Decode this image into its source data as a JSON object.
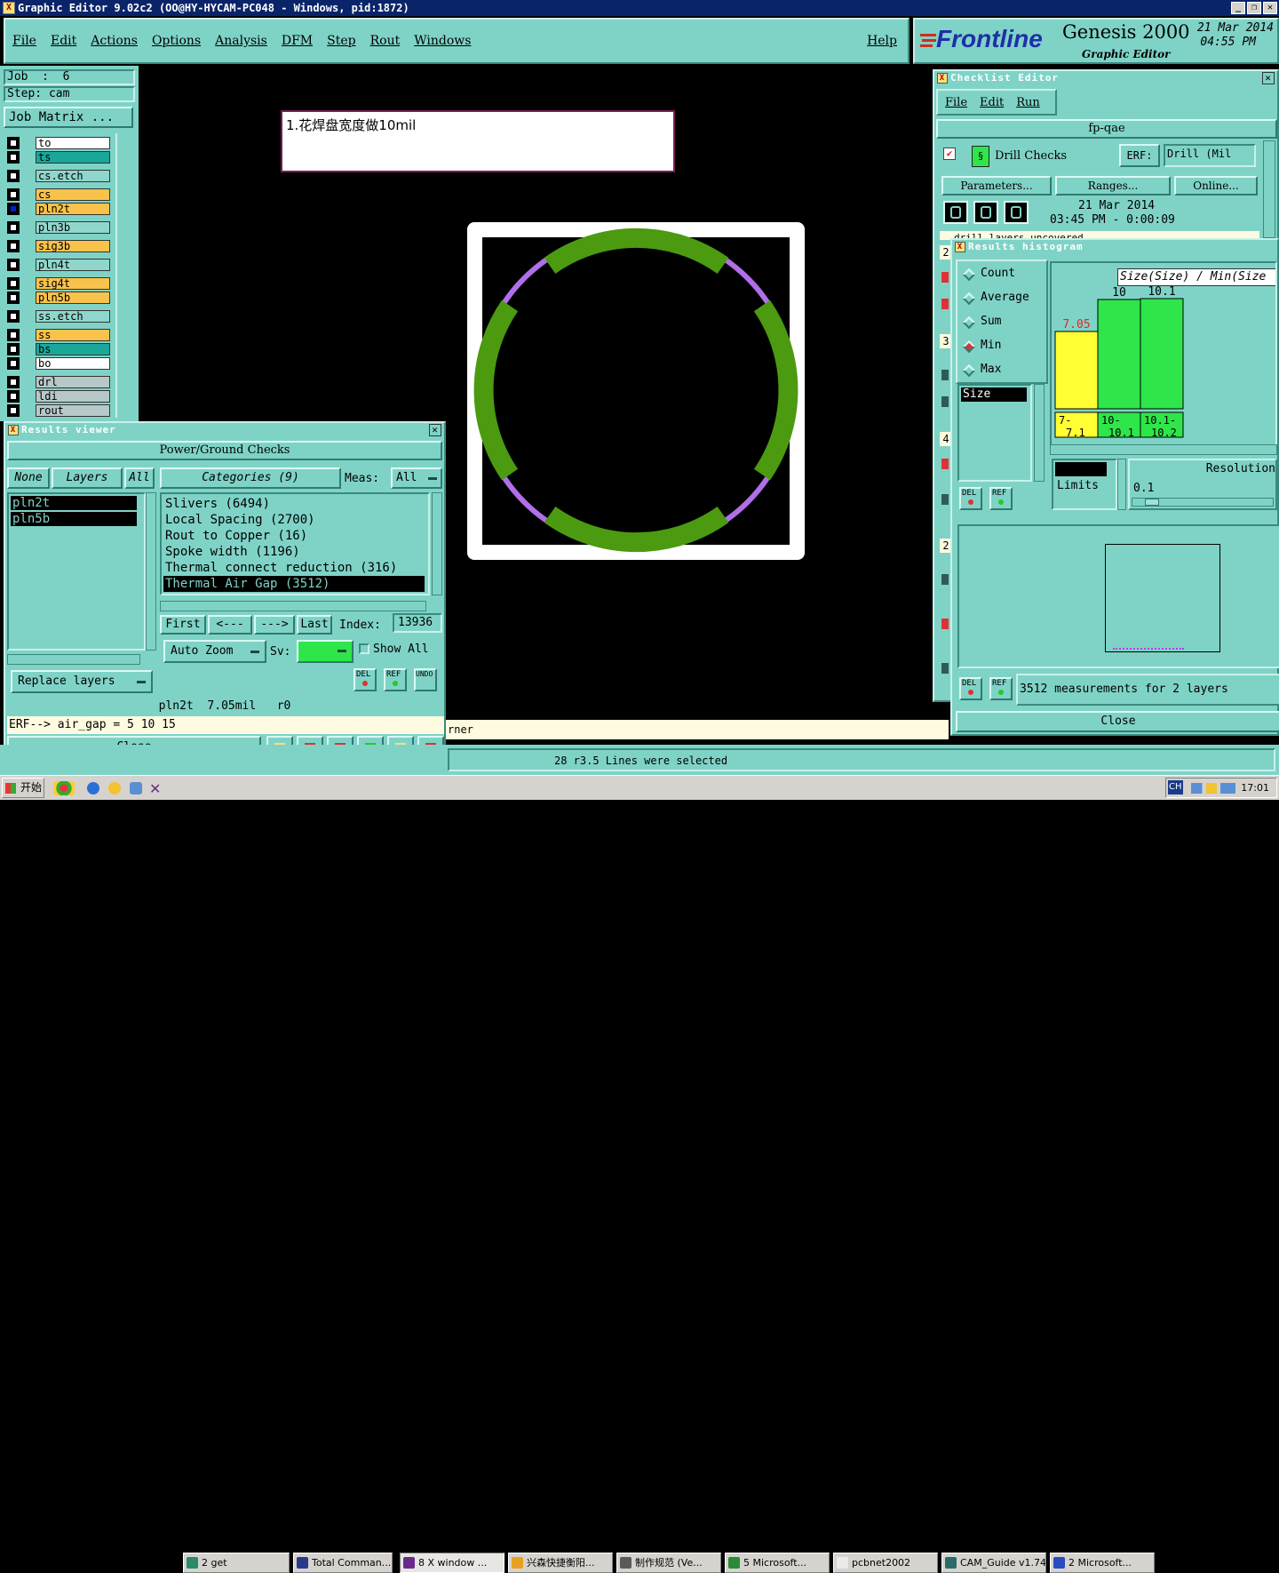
{
  "window": {
    "title": "Graphic Editor 9.02c2 (OO@HY-HYCAM-PC048 - Windows, pid:1872)"
  },
  "menubar": {
    "items": [
      "File",
      "Edit",
      "Actions",
      "Options",
      "Analysis",
      "DFM",
      "Step",
      "Rout",
      "Windows"
    ],
    "help": "Help"
  },
  "brand": {
    "logo": "Frontline",
    "product": "Genesis 2000",
    "subtitle": "Graphic Editor",
    "date": "21 Mar 2014",
    "time": "04:55 PM"
  },
  "job": {
    "job_label": "Job  :  6",
    "step_label": "Step: cam",
    "matrix_button": "Job Matrix ..."
  },
  "layers": [
    {
      "name": "to",
      "color": "#ffffff"
    },
    {
      "name": "ts",
      "color": "#1aa79a"
    },
    {
      "name": "cs.etch",
      "color": "#8fd7cc"
    },
    {
      "name": "cs",
      "color": "#f9c24a"
    },
    {
      "name": "pln2t",
      "color": "#f9c24a"
    },
    {
      "name": "pln3b",
      "color": "#8fd7cc"
    },
    {
      "name": "sig3b",
      "color": "#f9c24a"
    },
    {
      "name": "pln4t",
      "color": "#8fd7cc"
    },
    {
      "name": "sig4t",
      "color": "#f9c24a"
    },
    {
      "name": "pln5b",
      "color": "#f9c24a"
    },
    {
      "name": "ss.etch",
      "color": "#8fd7cc"
    },
    {
      "name": "ss",
      "color": "#f9c24a"
    },
    {
      "name": "bs",
      "color": "#1aa79a"
    },
    {
      "name": "bo",
      "color": "#ffffff"
    },
    {
      "name": "drl",
      "color": "#b8c8c8"
    },
    {
      "name": "ldi",
      "color": "#b8c8c8"
    },
    {
      "name": "rout",
      "color": "#b8c8c8"
    }
  ],
  "note": {
    "text": "1.花焊盘宽度做10mil"
  },
  "results_viewer": {
    "title": "Results viewer",
    "header": "Power/Ground Checks",
    "none_btn": "None",
    "layers_btn": "Layers",
    "all_btn": "All",
    "layer_list": [
      "pln2t",
      "pln5b"
    ],
    "categories_btn": "Categories (9)",
    "meas_label": "Meas:",
    "meas_value": "All",
    "categories": [
      "Slivers (6494)",
      "Local Spacing (2700)",
      "Rout to Copper (16)",
      "Spoke width (1196)",
      "Thermal connect reduction (316)",
      "Thermal Air Gap (3512)"
    ],
    "first": "First",
    "prev": "<---",
    "next": "--->",
    "last": "Last",
    "index_label": "Index:",
    "index_value": "13936",
    "auto_zoom": "Auto Zoom",
    "sv_label": "Sv:",
    "show_all": "Show All",
    "replace_layers": "Replace layers",
    "status": "pln2t  7.05mil   r0",
    "erf": "ERF--> air_gap = 5 10 15",
    "close": "Close",
    "del": "DEL",
    "ref": "REF",
    "undo": "UNDO"
  },
  "checklist": {
    "title": "Checklist Editor",
    "menu": [
      "File",
      "Edit",
      "Run"
    ],
    "name": "fp-qae",
    "action": "Drill Checks",
    "erf_label": "ERF:",
    "erf_value": "Drill (Mil",
    "parameters": "Parameters...",
    "ranges": "Ranges...",
    "online": "Online...",
    "date": "21 Mar 2014",
    "time": "03:45 PM - 0:00:09",
    "row_text": "drill_layers_uncovered",
    "side_numbers": [
      "2",
      "3",
      "4",
      "2"
    ]
  },
  "histogram": {
    "title": "Results histogram",
    "options": [
      "Count",
      "Average",
      "Sum",
      "Min",
      "Max"
    ],
    "selected": "Min",
    "header": "Size(Size) / Min(Size",
    "size_item": "Size",
    "bars": [
      {
        "label": "7.05",
        "value": 7.05,
        "range": "7- 7.1",
        "color": "#ffff33",
        "text_color": "#e8242f"
      },
      {
        "label": "10",
        "value": 10,
        "range": "10- 10.1",
        "color": "#2ee64a",
        "text_color": "#000000"
      },
      {
        "label": "10.1",
        "value": 10.1,
        "range": "10.1- 10.2",
        "color": "#2ee64a",
        "text_color": "#000000"
      }
    ],
    "size_limits": "Size\nLimits",
    "resolution_label": "Resolution",
    "resolution_value": "0.1",
    "measurements": "3512 measurements for 2 layers",
    "close": "Close"
  },
  "bottom": {
    "status": "28 r3.5 Lines were selected",
    "partial": "rner"
  },
  "taskbar": {
    "start": "开始",
    "items": [
      "2 get",
      "Total Comman...",
      "8 X window ...",
      "兴森快捷衡阳...",
      "制作规范 (Ve...",
      "5 Microsoft...",
      "pcbnet2002",
      "CAM_Guide v1.74",
      "2 Microsoft..."
    ],
    "clock": "17:01",
    "lang": "CH"
  }
}
